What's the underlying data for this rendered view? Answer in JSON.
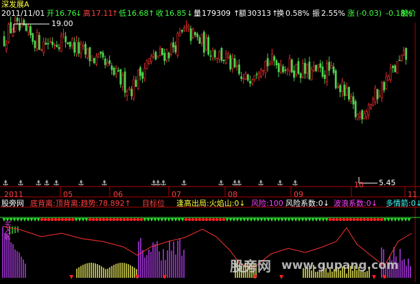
{
  "header": {
    "stock_name": "深发展A",
    "date": "2011/11/01",
    "open_label": "开",
    "open_value": "16.76",
    "high_label": "高",
    "high_value": "17.11",
    "low_label": "低",
    "low_value": "16.68",
    "close_label": "收",
    "close_value": "16.85",
    "volume_label": "量",
    "volume_value": "179309",
    "amount_label": "额",
    "amount_value": "30313",
    "turnover_label": "换",
    "turnover_value": "0.58%",
    "amplitude_label": "振",
    "amplitude_value": "2.55%",
    "change_label": "涨",
    "change_value": "(-0.03)",
    "change_pct": "-0.18%",
    "trailing_label": "股价"
  },
  "price_chart": {
    "high_marker": "19.00",
    "low_marker": "5.45",
    "month_labels": [
      "2011",
      "05",
      "06",
      "07",
      "08",
      "09",
      "10",
      "11"
    ]
  },
  "indicator_bar": {
    "site": "股旁网",
    "items": [
      "底背离:顶背离:趋势:78.892↑",
      "目标位",
      "逢高出局:火焰山:0↓",
      "风险:100",
      "风险系数:0↓",
      "波浪系数:0↓",
      "多情箭:0↓"
    ],
    "item_colors": [
      "#ff4040",
      "#ff4040",
      "#ffff40",
      "#ff40ff",
      "#ffffff",
      "#ff40ff",
      "#40ffff"
    ]
  },
  "side_label": "买入区",
  "watermark": {
    "text": "股旁网",
    "url": "www.gupang.com"
  },
  "colors": {
    "up": "#ff3232",
    "down": "#4fd14f",
    "axis": "#b00000",
    "line": "#ff3030",
    "label_green": "#40ff40",
    "label_red": "#ff4040",
    "label_white": "#ffffff",
    "label_cyan": "#40ffff"
  },
  "chart_data": {
    "type": "candlestick",
    "x": [
      "2011-04",
      "2011-05",
      "2011-06",
      "2011-07",
      "2011-08",
      "2011-09",
      "2011-10",
      "2011-11"
    ],
    "close": [
      18.0,
      16.5,
      14.4,
      16.8,
      15.6,
      14.6,
      14.3,
      16.85
    ],
    "ymax": 19.0,
    "ymin": 5.45
  }
}
